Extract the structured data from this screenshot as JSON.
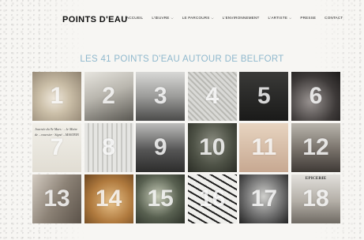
{
  "header": {
    "logo": "POINTS D'EAU",
    "nav": [
      {
        "label": "ACCUEIL",
        "dropdown": false
      },
      {
        "label": "L'ŒUVRE",
        "dropdown": true
      },
      {
        "label": "LE PARCOURS",
        "dropdown": true
      },
      {
        "label": "L'ENVIRONNEMENT",
        "dropdown": false
      },
      {
        "label": "L'ARTISTE",
        "dropdown": true
      },
      {
        "label": "PRESSE",
        "dropdown": false
      },
      {
        "label": "CONTACT",
        "dropdown": false
      }
    ]
  },
  "main": {
    "title": "LES 41 POINTS D'EAU AUTOUR DE BELFORT",
    "tiles": [
      {
        "number": "1"
      },
      {
        "number": "2"
      },
      {
        "number": "3"
      },
      {
        "number": "4"
      },
      {
        "number": "5"
      },
      {
        "number": "6"
      },
      {
        "number": "7",
        "handwriting": "Journée du 9e Mars · ...le Maire de ...voursier · Signé ...MASTEIN"
      },
      {
        "number": "8"
      },
      {
        "number": "9"
      },
      {
        "number": "10"
      },
      {
        "number": "11"
      },
      {
        "number": "12"
      },
      {
        "number": "13"
      },
      {
        "number": "14"
      },
      {
        "number": "15"
      },
      {
        "number": "16"
      },
      {
        "number": "17"
      },
      {
        "number": "18",
        "caption": "EPICERIE"
      }
    ]
  }
}
